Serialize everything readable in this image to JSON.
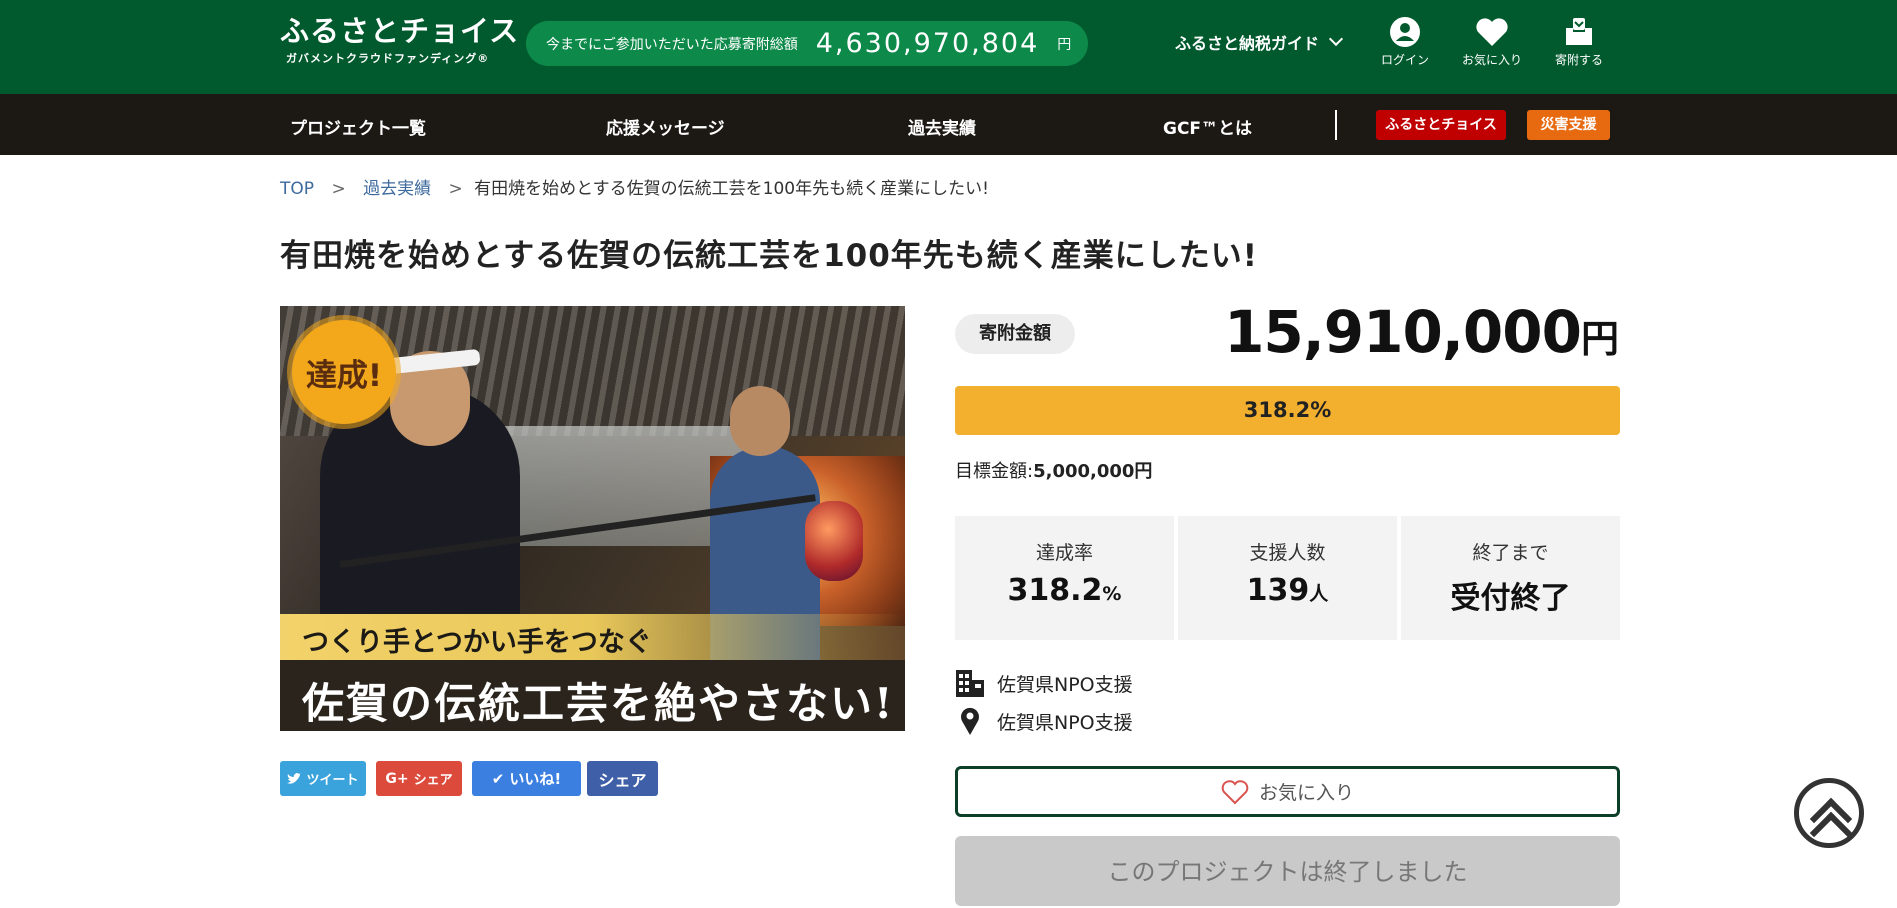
{
  "header": {
    "logo_main": "ふるさとチョイス",
    "logo_sub": "ガバメントクラウドファンディング®",
    "total_label": "今までにご参加いただいた応募寄附総額",
    "total_amount": "4,630,970,804",
    "total_unit": "円",
    "guide_label": "ふるさと納税ガイド",
    "icons": {
      "login": "ログイン",
      "favorites": "お気に入り",
      "donate": "寄附する"
    }
  },
  "nav": {
    "items": [
      "プロジェクト一覧",
      "応援メッセージ",
      "過去実績",
      "GCF™とは"
    ],
    "badge_furusato": "ふるさとチョイス",
    "badge_disaster": "災害支援",
    "colors": {
      "furusato": "#c00000",
      "disaster": "#e86a10"
    }
  },
  "breadcrumb": {
    "top": "TOP",
    "sep": ">",
    "past": "過去実績",
    "current": "有田焼を始めとする佐賀の伝統工芸を100年先も続く産業にしたい!"
  },
  "page_title": "有田焼を始めとする佐賀の伝統工芸を100年先も続く産業にしたい!",
  "hero": {
    "badge": "達成!",
    "caption1": "つくり手とつかい手をつなぐ",
    "caption2": "佐賀の伝統工芸を絶やさない!"
  },
  "share": {
    "tweet": "ツイート",
    "gplus": "シェア",
    "like": "いいね!",
    "fb_share": "シェア"
  },
  "funding": {
    "label": "寄附金額",
    "amount": "15,910,000",
    "unit": "円",
    "progress_percent": 318.2,
    "progress_text": "318.2%",
    "target_label": "目標金額:",
    "target_value": "5,000,000円",
    "accent_color": "#f2b02e"
  },
  "stats": [
    {
      "label": "達成率",
      "value": "318.2",
      "unit": "%"
    },
    {
      "label": "支援人数",
      "value": "139",
      "unit": "人"
    },
    {
      "label": "終了まで",
      "value": "受付終了",
      "unit": ""
    }
  ],
  "info": {
    "organization": "佐賀県NPO支援",
    "location": "佐賀県NPO支援"
  },
  "buttons": {
    "favorite": "お気に入り",
    "closed": "このプロジェクトは終了しました"
  }
}
